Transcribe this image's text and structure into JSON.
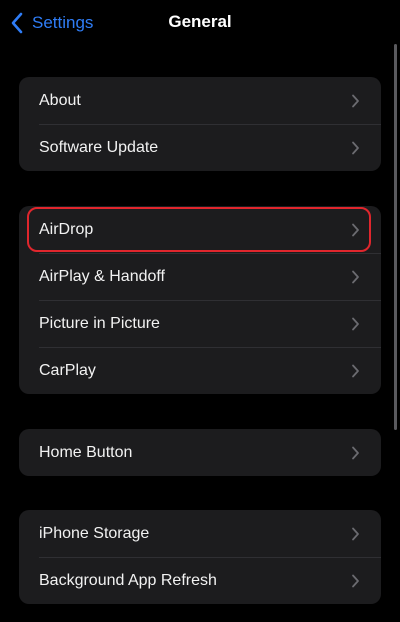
{
  "navbar": {
    "back_label": "Settings",
    "title": "General"
  },
  "groups": [
    {
      "items": [
        {
          "label": "About"
        },
        {
          "label": "Software Update"
        }
      ]
    },
    {
      "items": [
        {
          "label": "AirDrop"
        },
        {
          "label": "AirPlay & Handoff"
        },
        {
          "label": "Picture in Picture"
        },
        {
          "label": "CarPlay"
        }
      ]
    },
    {
      "items": [
        {
          "label": "Home Button"
        }
      ]
    },
    {
      "items": [
        {
          "label": "iPhone Storage"
        },
        {
          "label": "Background App Refresh"
        }
      ]
    }
  ],
  "icons": {
    "back": "chevron-left-icon",
    "row": "chevron-right-icon"
  },
  "colors": {
    "background": "#000000",
    "group_background": "#1c1c1e",
    "accent": "#2f7df6",
    "highlight": "#e0262d",
    "chevron": "#6b6b70"
  }
}
